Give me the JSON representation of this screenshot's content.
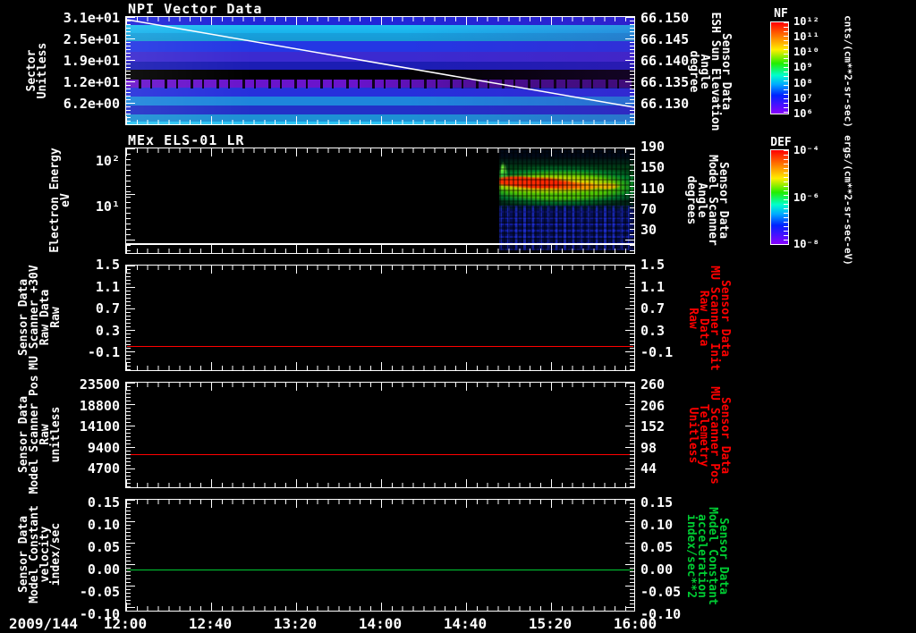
{
  "footer": {
    "date_label": "2009/144",
    "time_ticks": [
      "12:00",
      "12:40",
      "13:20",
      "14:00",
      "14:40",
      "15:20",
      "16:00"
    ]
  },
  "panels": [
    {
      "title": "NPI Vector Data",
      "left_title_lines": [
        "Sector",
        "Unitless"
      ],
      "left_ticks": [
        "3.1e+01",
        "2.5e+01",
        "1.9e+01",
        "1.2e+01",
        "6.2e+00"
      ],
      "right_ticks": [
        "66.150",
        "66.145",
        "66.140",
        "66.135",
        "66.130"
      ],
      "right_title_lines": [
        "Sensor Data",
        "ESH Sun Elevation",
        "Angle",
        "degree"
      ]
    },
    {
      "title": "MEx ELS-01 LR",
      "left_title_lines": [
        "Electron Energy",
        "eV"
      ],
      "left_ticks": [
        "10²",
        "10¹"
      ],
      "right_ticks": [
        "190",
        "150",
        "110",
        "70",
        "30"
      ],
      "right_title_lines": [
        "Sensor Data",
        "Model Scanner",
        "Angle",
        "degrees"
      ]
    },
    {
      "left_title_lines": [
        "Sensor Data",
        "MU Scanner +30V",
        "Raw Data",
        "Raw"
      ],
      "left_ticks": [
        "1.5",
        "1.1",
        "0.7",
        "0.3",
        "-0.1"
      ],
      "right_ticks": [
        "1.5",
        "1.1",
        "0.7",
        "0.3",
        "-0.1"
      ],
      "right_title_lines": [
        "Sensor Data",
        "MU Scanner Init",
        "Raw Data",
        "Raw"
      ],
      "line_color": "#ff0000",
      "line_value": 0.0
    },
    {
      "left_title_lines": [
        "Sensor Data",
        "Model Scanner Pos",
        "Raw",
        "unitless"
      ],
      "left_ticks": [
        "23500",
        "18800",
        "14100",
        "9400",
        "4700"
      ],
      "right_ticks": [
        "260",
        "206",
        "152",
        "98",
        "44"
      ],
      "right_title_lines": [
        "Sensor Data",
        "MU Scanner Pos",
        "Telemetry",
        "Unitless"
      ],
      "line_color": "#ff0000",
      "line_value": 7900
    },
    {
      "left_title_lines": [
        "Sensor Data",
        "Model Constant",
        "velocity",
        "index/sec"
      ],
      "left_ticks": [
        "0.15",
        "0.10",
        "0.05",
        "0.00",
        "-0.05",
        "-0.10"
      ],
      "right_ticks": [
        "0.15",
        "0.10",
        "0.05",
        "0.00",
        "-0.05",
        "-0.10"
      ],
      "right_title_lines": [
        "Sensor Data",
        "Model Constant",
        "acceleration",
        "index/sec**2"
      ],
      "line_color": "#00cc33",
      "line_value": 0.0
    }
  ],
  "colorbars": [
    {
      "label": "NF",
      "ticks": [
        "10¹²",
        "10¹¹",
        "10¹⁰",
        "10⁹",
        "10⁸",
        "10⁷",
        "10⁶"
      ],
      "units": "cnts/(cm**2-sr-sec)"
    },
    {
      "label": "DEF",
      "ticks": [
        "10⁻⁴",
        "10⁻⁶",
        "10⁻⁸"
      ],
      "units": "ergs/(cm**2-sr-sec-eV)"
    }
  ],
  "chart_data": [
    {
      "type": "heatmap",
      "title": "NPI Vector Data",
      "x_range": [
        "2009/144 12:00",
        "2009/144 16:00"
      ],
      "x_ticks": [
        "12:00",
        "12:40",
        "13:20",
        "14:00",
        "14:40",
        "15:20",
        "16:00"
      ],
      "ylabel": "Sector Unitless",
      "ylim": [
        0,
        32
      ],
      "y_ticks": [
        6.2,
        12,
        19,
        25,
        31
      ],
      "value_label": "NF",
      "value_units": "cnts/(cm**2-sr-sec)",
      "value_scale": "log",
      "value_range": [
        1000000.0,
        1000000000000.0
      ],
      "summary": "Horizontal sector bands of near-constant count rate across all 4 hours: bright cyan bands (~1e9) near sectors 28-29, 9-11 and 1-2; medium blue (~1e8) elsewhere; a black no-count band near sectors 15-16; a noisy purple band (~1e6-1e7) with black dropouts near sectors 13-14; slight purple dimming toward 16:00.",
      "overlay_line": {
        "name": "Sensor Data ESH Sun Elevation Angle (right axis, degree)",
        "color": "#ffffff",
        "x": [
          "12:00",
          "16:00"
        ],
        "y": [
          66.1495,
          66.1295
        ],
        "right_axis_ticks": [
          66.15,
          66.145,
          66.14,
          66.135,
          66.13
        ]
      }
    },
    {
      "type": "heatmap",
      "title": "MEx ELS-01 LR",
      "ylabel": "Electron Energy eV",
      "yscale": "log",
      "ylim": [
        2,
        300
      ],
      "y_ticks": [
        "10^1",
        "10^2"
      ],
      "value_label": "DEF",
      "value_units": "ergs/(cm**2-sr-sec-eV)",
      "value_scale": "log",
      "value_range": [
        1e-08,
        0.0001
      ],
      "summary": "Black (no data) from 12:00 until ~14:55; from ~14:55 to 16:00 hot plasma: red/orange peak DEF ~1e-4 at 15-40 eV strongest 14:58-15:35, green ~1e-6 envelope from ~8-100 eV, sparse blue ~1e-8 speckle below ~8 eV; thin white horizontal line near the lowest energy bin.",
      "right_axis": {
        "label": "Sensor Data Model Scanner Angle degrees",
        "ticks": [
          30,
          70,
          110,
          150,
          190
        ]
      }
    },
    {
      "type": "line",
      "ylabel": "Sensor Data MU Scanner +30V Raw Data Raw",
      "ylim": [
        -0.1,
        1.5
      ],
      "y_ticks": [
        1.5,
        1.1,
        0.7,
        0.3,
        -0.1
      ],
      "series": [
        {
          "name": "MU Scanner +30V Raw",
          "color": "#ff0000",
          "x": [
            "12:00",
            "16:00"
          ],
          "y": [
            0.0,
            0.0
          ]
        }
      ],
      "right_axis": {
        "label": "Sensor Data MU Scanner Init Raw Data Raw",
        "ticks": [
          1.5,
          1.1,
          0.7,
          0.3,
          -0.1
        ]
      }
    },
    {
      "type": "line",
      "ylabel": "Sensor Data Model Scanner Pos Raw unitless",
      "ylim": [
        0,
        23500
      ],
      "y_ticks": [
        23500,
        18800,
        14100,
        9400,
        4700
      ],
      "series": [
        {
          "name": "Model Scanner Pos Raw",
          "color": "#ff0000",
          "x": [
            "12:00",
            "16:00"
          ],
          "y": [
            7900,
            7900
          ]
        }
      ],
      "right_axis": {
        "label": "Sensor Data MU Scanner Pos Telemetry Unitless",
        "ticks": [
          260,
          206,
          152,
          98,
          44
        ]
      }
    },
    {
      "type": "line",
      "ylabel": "Sensor Data Model Constant velocity index/sec",
      "ylim": [
        -0.1,
        0.15
      ],
      "y_ticks": [
        0.15,
        0.1,
        0.05,
        0.0,
        -0.05,
        -0.1
      ],
      "series": [
        {
          "name": "Model Constant velocity",
          "color": "#00cc33",
          "x": [
            "12:00",
            "16:00"
          ],
          "y": [
            0.0,
            0.0
          ]
        }
      ],
      "right_axis": {
        "label": "Sensor Data Model Constant acceleration index/sec**2",
        "ticks": [
          0.15,
          0.1,
          0.05,
          0.0,
          -0.05,
          -0.1
        ]
      }
    }
  ]
}
